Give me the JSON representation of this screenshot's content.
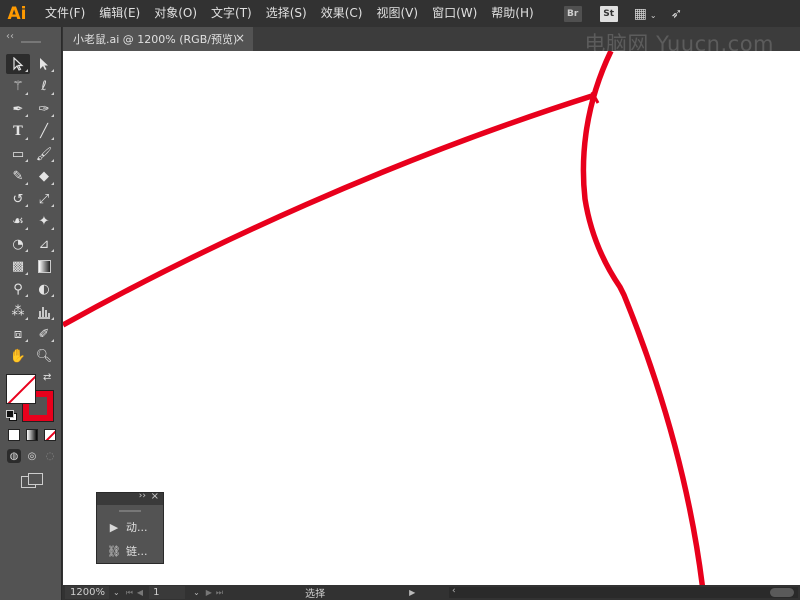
{
  "app": {
    "logo": "Ai"
  },
  "menu": {
    "items": [
      "文件(F)",
      "编辑(E)",
      "对象(O)",
      "文字(T)",
      "选择(S)",
      "效果(C)",
      "视图(V)",
      "窗口(W)",
      "帮助(H)"
    ],
    "bridge": "Br",
    "stock": "St"
  },
  "document": {
    "tab_title": "小老鼠.ai @ 1200% (RGB/预览)",
    "close": "×",
    "watermark": "电脑网 Yuucn.com"
  },
  "toolbar": {
    "collapse": "‹‹",
    "tools": [
      [
        "selection-tool",
        "direct-selection-tool"
      ],
      [
        "magic-wand-tool",
        "lasso-tool"
      ],
      [
        "pen-tool",
        "curvature-tool"
      ],
      [
        "type-tool",
        "line-segment-tool"
      ],
      [
        "rectangle-tool",
        "paintbrush-tool"
      ],
      [
        "shaper-tool",
        "eraser-tool"
      ],
      [
        "rotate-tool",
        "scale-tool"
      ],
      [
        "warp-tool",
        "puppet-warp-tool"
      ],
      [
        "shape-builder-tool",
        "perspective-grid-tool"
      ],
      [
        "mesh-tool",
        "gradient-tool"
      ],
      [
        "eyedropper-tool",
        "blend-tool"
      ],
      [
        "symbol-sprayer-tool",
        "column-graph-tool"
      ],
      [
        "artboard-tool",
        "slice-tool"
      ],
      [
        "hand-tool",
        "zoom-tool"
      ]
    ]
  },
  "colors": {
    "fill": "none",
    "stroke": "#e8001c",
    "path": "#e8001c"
  },
  "float_panel": {
    "collapse": "››",
    "close": "×",
    "items": [
      {
        "icon": "play-icon",
        "label": "动..."
      },
      {
        "icon": "link-icon",
        "label": "链..."
      }
    ]
  },
  "status": {
    "zoom": "1200%",
    "artboard": "1",
    "tool": "选择"
  }
}
